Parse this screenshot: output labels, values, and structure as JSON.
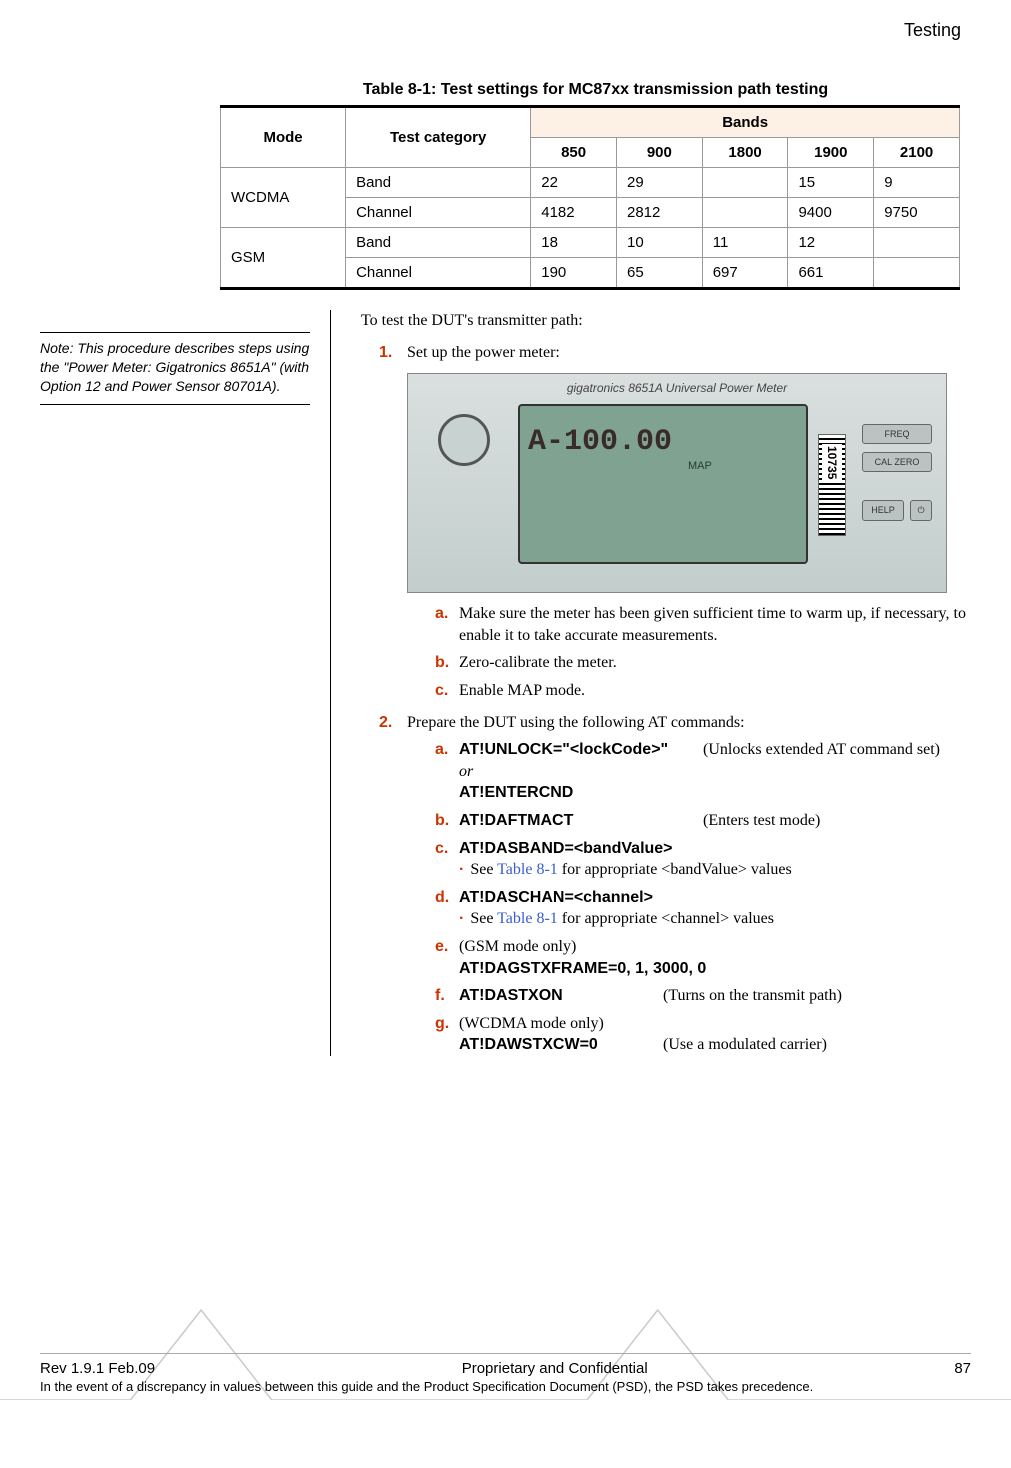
{
  "header": {
    "section": "Testing"
  },
  "table": {
    "caption": "Table 8-1:  Test settings for MC87xx transmission path testing",
    "col_mode": "Mode",
    "col_cat": "Test category",
    "col_bands": "Bands",
    "band_headers": [
      "850",
      "900",
      "1800",
      "1900",
      "2100"
    ],
    "rows": [
      {
        "mode": "WCDMA",
        "cat": "Band",
        "v": [
          "22",
          "29",
          "",
          "15",
          "9"
        ]
      },
      {
        "mode": "",
        "cat": "Channel",
        "v": [
          "4182",
          "2812",
          "",
          "9400",
          "9750"
        ]
      },
      {
        "mode": "GSM",
        "cat": "Band",
        "v": [
          "18",
          "10",
          "11",
          "12",
          ""
        ]
      },
      {
        "mode": "",
        "cat": "Channel",
        "v": [
          "190",
          "65",
          "697",
          "661",
          ""
        ]
      }
    ]
  },
  "sidenote": "Note:  This procedure describes steps using the \"Power Meter: Gigatronics 8651A\" (with Option 12 and Power Sensor 80701A).",
  "intro": "To test the DUT's transmitter path:",
  "meter": {
    "brand": "gigatronics    8651A    Universal  Power  Meter",
    "reading": "A-100.00",
    "sub1": "MAP",
    "barcode": "10735",
    "btn_freq": "FREQ",
    "btn_cal": "CAL ZERO",
    "btn_help": "HELP"
  },
  "steps": {
    "n1": "1.",
    "n1_text": "Set up the power meter:",
    "n1a": "a.",
    "n1a_text": "Make sure the meter has been given sufficient time to warm up, if necessary, to enable it to take accurate measurements.",
    "n1b": "b.",
    "n1b_text": "Zero-calibrate the meter.",
    "n1c": "c.",
    "n1c_text": "Enable MAP mode.",
    "n2": "2.",
    "n2_text": "Prepare the DUT using the following AT commands:",
    "n2a": "a.",
    "n2a_cmd": "AT!UNLOCK=\"<lockCode>\"",
    "n2a_desc": "(Unlocks extended AT command set)",
    "n2a_or": "or",
    "n2a_cmd2": "AT!ENTERCND",
    "n2b": "b.",
    "n2b_cmd": "AT!DAFTMACT",
    "n2b_desc": "(Enters test mode)",
    "n2c": "c.",
    "n2c_cmd": "AT!DASBAND=<bandValue>",
    "n2c_bullet_see": "See ",
    "n2c_bullet_ref": "Table 8-1",
    "n2c_bullet_rest": " for appropriate <bandValue> values",
    "n2d": "d.",
    "n2d_cmd": "AT!DASCHAN=<channel>",
    "n2d_bullet_see": "See ",
    "n2d_bullet_ref": "Table 8-1",
    "n2d_bullet_rest": " for appropriate <channel> values",
    "n2e": "e.",
    "n2e_pre": "(GSM mode only)",
    "n2e_cmd": "AT!DAGSTXFRAME=0, 1, 3000, 0",
    "n2f": "f.",
    "n2f_cmd": "AT!DASTXON",
    "n2f_desc": "(Turns on the transmit path)",
    "n2g": "g.",
    "n2g_pre": "(WCDMA mode only)",
    "n2g_cmd": "AT!DAWSTXCW=0",
    "n2g_desc": "(Use a modulated carrier)"
  },
  "footer": {
    "rev": "Rev 1.9.1  Feb.09",
    "center": "Proprietary and Confidential",
    "page": "87",
    "note": "In the event of a discrepancy in values between this guide and the Product Specification Document (PSD), the PSD takes precedence."
  }
}
